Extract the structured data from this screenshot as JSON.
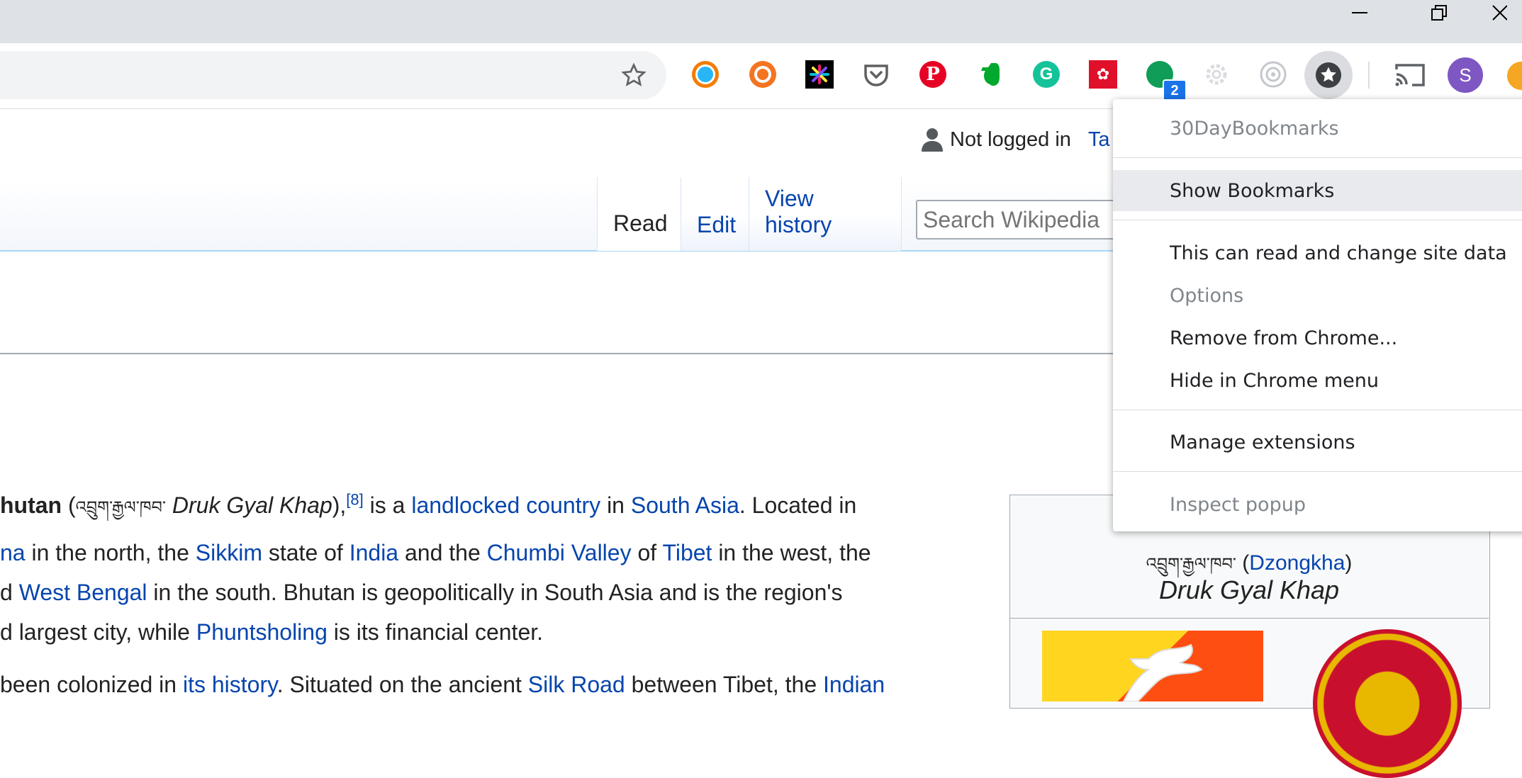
{
  "extensions": [
    {
      "name": "30DayBookmarks-cute-eye-ext",
      "color": "#ef6c00"
    },
    {
      "name": "ubuntu-ext",
      "color": "#ef6c00"
    },
    {
      "name": "color-picker-ext",
      "color": "#000000"
    },
    {
      "name": "pocket-ext",
      "color": "#555555"
    },
    {
      "name": "pinterest-ext",
      "color": "#e60023"
    },
    {
      "name": "evernote-ext",
      "color": "#00a82d"
    },
    {
      "name": "grammarly-ext",
      "color": "#15c39a"
    },
    {
      "name": "huawei-ext",
      "color": "#e60012"
    },
    {
      "name": "green-chat-ext",
      "color": "#0f9d58"
    },
    {
      "name": "gear-ext",
      "color": "#dadce0"
    },
    {
      "name": "target-ext",
      "color": "#bdc1c6"
    }
  ],
  "badge": "2",
  "profile_initial": "S",
  "wiki": {
    "not_logged_in": "Not logged in",
    "talk": "Ta",
    "tabs": {
      "read": "Read",
      "edit": "Edit",
      "view_history": "View history"
    },
    "search_placeholder": "Search Wikipedia"
  },
  "article": {
    "l1": {
      "a": "hutan",
      "b": " (",
      "tibetan": "འབྲུག་རྒྱལ་ཁབ་",
      "c": " Druk Gyal Khap",
      "d": "),",
      "sup": "[8]",
      "e": " is a ",
      "link1": "landlocked country",
      "f": " in ",
      "link2": "South Asia",
      "g": ". Located in"
    },
    "l2": {
      "link1": "na",
      "a": " in the north, the ",
      "link2": "Sikkim",
      "b": " state of ",
      "link3": "India",
      "c": " and the ",
      "link4": "Chumbi Valley",
      "d": " of ",
      "link5": "Tibet",
      "e": " in the west, the"
    },
    "l3": {
      "a": "d ",
      "link1": "West Bengal",
      "b": " in the south. Bhutan is geopolitically in South Asia and is the region's"
    },
    "l4": {
      "a": "d largest city, while ",
      "link1": "Phuntsholing",
      "b": " is its financial center."
    },
    "l5": {
      "a": "been colonized in ",
      "link1": "its history",
      "b": ". Situated on the ancient ",
      "link2": "Silk Road",
      "c": " between Tibet, the ",
      "link3": "Indian"
    }
  },
  "infobox": {
    "tibetan": "འབྲུག་རྒྱལ་ཁབ་",
    "lang_open": "(",
    "lang": "Dzongkha",
    "lang_close": ")",
    "name": "Druk Gyal Khap"
  },
  "menu": {
    "title": "30DayBookmarks",
    "show_bookmarks": "Show Bookmarks",
    "site_data": "This can read and change site data",
    "options": "Options",
    "remove": "Remove from Chrome...",
    "hide": "Hide in Chrome menu",
    "manage": "Manage extensions",
    "inspect": "Inspect popup"
  }
}
